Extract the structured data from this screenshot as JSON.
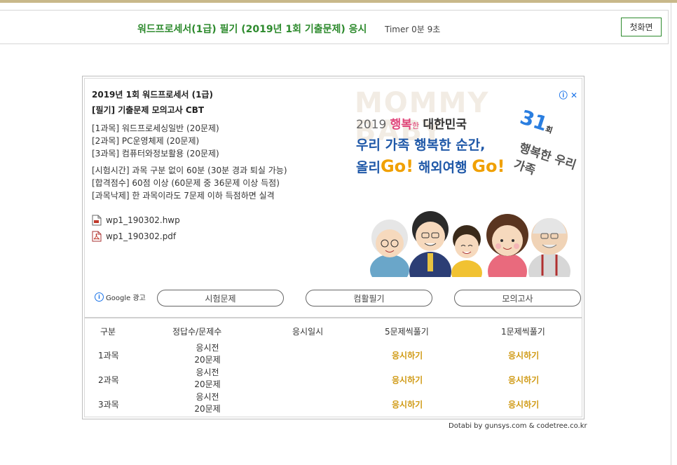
{
  "header": {
    "title": "워드프로세서(1급) 필기 (2019년 1회 기출문제) 응시",
    "timer": "Timer 0분 9초",
    "home_button": "첫화면"
  },
  "info": {
    "line1": "2019년 1회 워드프로세서 (1급)",
    "line2": "[필기] 기출문제 모의고사 CBT",
    "subjects": [
      "[1과목] 워드프로세싱일반 (20문제)",
      "[2과목] PC운영체제 (20문제)",
      "[3과목] 컴퓨터와정보활용 (20문제)"
    ],
    "rules": [
      "[시험시간] 과목 구분 없이 60분 (30분 경과 퇴실 가능)",
      "[합격점수] 60점 이상 (60문제 중 36문제 이상 득점)",
      "[과목낙제] 한 과목이라도 7문제 이하 득점하면 실격"
    ],
    "files": [
      {
        "name": "wp1_190302.hwp",
        "icon": "hwp-file-icon"
      },
      {
        "name": "wp1_190302.pdf",
        "icon": "pdf-file-icon"
      }
    ]
  },
  "ad": {
    "bg_text": "MOMMY BABY",
    "line1_year": "2019",
    "line1_happy": "행복",
    "line1_han": "한",
    "line1_country": "대한민국",
    "line2": "우리 가족 행복한 순간,",
    "line3_a": "올리",
    "line3_go1": "Go!",
    "line3_b": " 해외여행 ",
    "line3_go2": "Go!",
    "badge_number": "31",
    "badge_small": "회",
    "badge_text": "행복한 우리가족",
    "google_label": "Google 광고",
    "buttons": [
      "시험문제",
      "컴활필기",
      "모의고사"
    ]
  },
  "table": {
    "headers": [
      "구분",
      "정답수/문제수",
      "응시일시",
      "5문제씩풀기",
      "1문제씩풀기"
    ],
    "rows": [
      {
        "subject": "1과목",
        "status": "응시전",
        "count": "20문제",
        "date": "",
        "go5": "응시하기",
        "go1": "응시하기"
      },
      {
        "subject": "2과목",
        "status": "응시전",
        "count": "20문제",
        "date": "",
        "go5": "응시하기",
        "go1": "응시하기"
      },
      {
        "subject": "3과목",
        "status": "응시전",
        "count": "20문제",
        "date": "",
        "go5": "응시하기",
        "go1": "응시하기"
      }
    ]
  },
  "footer": {
    "credit": "Dotabi by gunsys.com & codetree.co.kr"
  },
  "colors": {
    "title_green": "#2e8b2e",
    "action_gold": "#d09a14",
    "ad_blue": "#1f58a8",
    "ad_orange": "#f0a000"
  }
}
